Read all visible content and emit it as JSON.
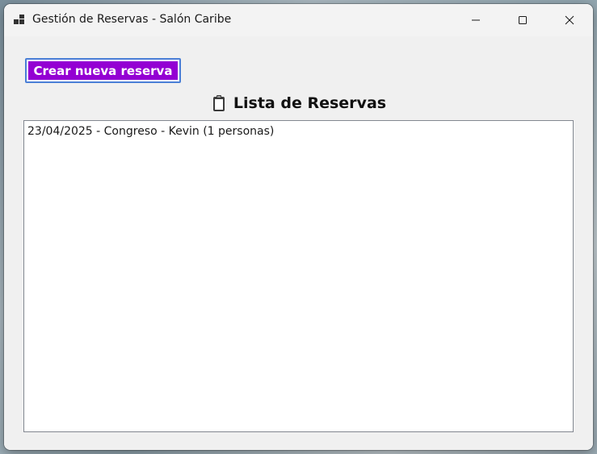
{
  "window": {
    "title": "Gestión de Reservas - Salón Caribe",
    "controls": {
      "minimize": "minimize-icon",
      "maximize": "maximize-icon",
      "close": "close-icon"
    }
  },
  "toolbar": {
    "create_label": "Crear nueva reserva",
    "create_bg": "#9400d3",
    "create_fg": "#ffffff"
  },
  "list": {
    "heading": "Lista de Reservas",
    "heading_icon": "clipboard-icon",
    "items": [
      {
        "label": "23/04/2025 - Congreso - Kevin (1 personas)"
      }
    ]
  }
}
